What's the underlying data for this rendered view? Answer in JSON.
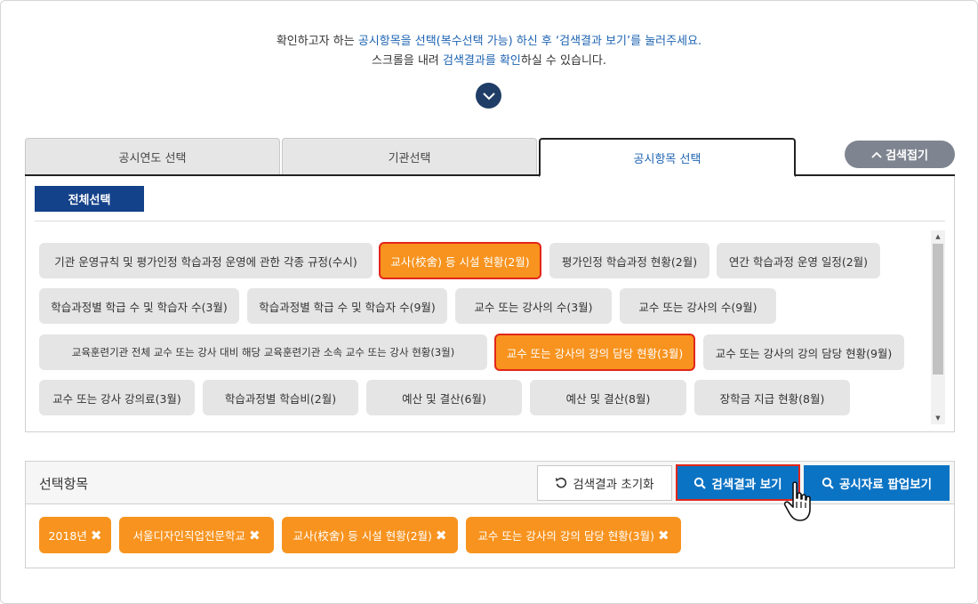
{
  "intro": {
    "line1_a": "확인하고자 하는 ",
    "line1_b": "공시항목을 선택(복수선택 가능) 하신 후 ‘검색결과 보기’를 눌러주세요.",
    "line2_a": "스크롤을 내려 ",
    "line2_b": "검색결과를 확인",
    "line2_c": "하실 수 있습니다."
  },
  "tabs": [
    {
      "label": "공시연도 선택"
    },
    {
      "label": "기관선택"
    },
    {
      "label": "공시항목 선택"
    }
  ],
  "collapse_label": "검색접기",
  "select_all": "전체선택",
  "items": [
    {
      "label": "기관 운영규칙 및 평가인정 학습과정 운영에 관한 각종 규정(수시)",
      "selected": false
    },
    {
      "label": "교사(校舍) 등 시설 현황(2월)",
      "selected": true
    },
    {
      "label": "평가인정 학습과정 현황(2월)",
      "selected": false
    },
    {
      "label": "연간 학습과정 운영 일정(2월)",
      "selected": false
    },
    {
      "label": "학습과정별 학급 수 및 학습자 수(3월)",
      "selected": false
    },
    {
      "label": "학습과정별 학급 수 및 학습자 수(9월)",
      "selected": false
    },
    {
      "label": "교수 또는 강사의 수(3월)",
      "selected": false
    },
    {
      "label": "교수 또는 강사의 수(9월)",
      "selected": false
    },
    {
      "label": "교육훈련기관 전체 교수 또는 강사 대비 해당 교육훈련기관 소속 교수 또는 강사 현황(3월)",
      "selected": false
    },
    {
      "label": "교수 또는 강사의 강의 담당 현황(3월)",
      "selected": true
    },
    {
      "label": "교수 또는 강사의 강의 담당 현황(9월)",
      "selected": false
    },
    {
      "label": "교수 또는 강사 강의료(3월)",
      "selected": false
    },
    {
      "label": "학습과정별 학습비(2월)",
      "selected": false
    },
    {
      "label": "예산 및 결산(6월)",
      "selected": false
    },
    {
      "label": "예산 및 결산(8월)",
      "selected": false
    },
    {
      "label": "장학금 지급 현황(8월)",
      "selected": false
    }
  ],
  "selection": {
    "title": "선택항목",
    "reset_label": "검색결과 초기화",
    "search_label": "검색결과 보기",
    "popup_label": "공시자료 팝업보기",
    "tags": [
      {
        "label": "2018년"
      },
      {
        "label": "서울디자인직업전문학교"
      },
      {
        "label": "교사(校舍) 등 시설 현황(2월)"
      },
      {
        "label": "교수 또는 강사의 강의 담당 현황(3월)"
      }
    ]
  },
  "colors": {
    "accent_blue": "#0b73c4",
    "navy": "#14428a",
    "orange": "#f7931e",
    "highlight_border": "#e2261b",
    "chip_gray": "#e5e5e5"
  },
  "icons": [
    "chevron-down-icon",
    "chevron-up-icon",
    "search-icon",
    "reset-icon",
    "close-icon",
    "hand-cursor-icon"
  ]
}
